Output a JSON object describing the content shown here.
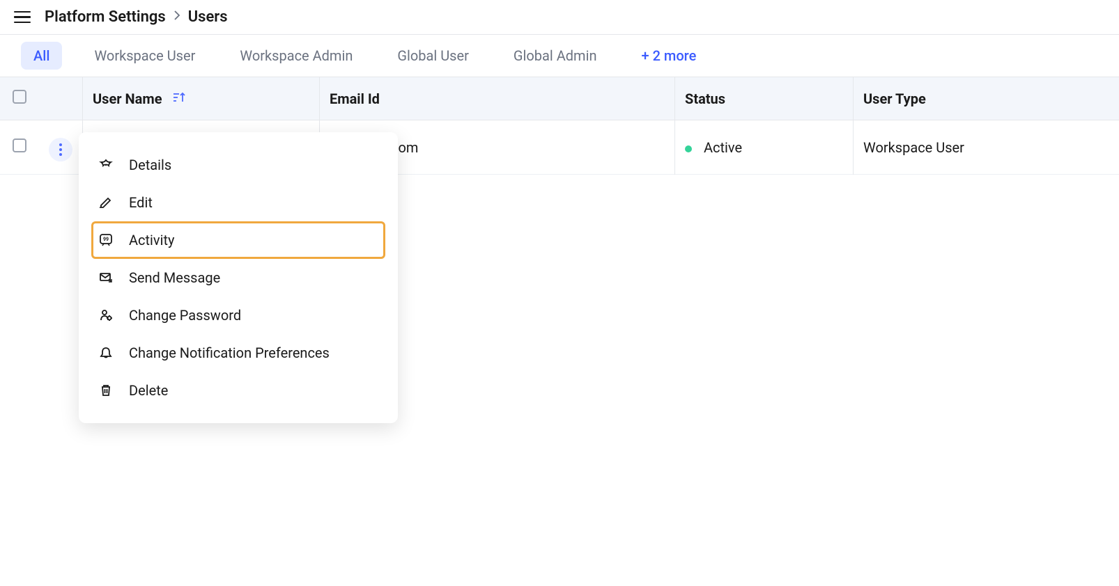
{
  "breadcrumb": {
    "parent": "Platform Settings",
    "current": "Users"
  },
  "tabs": {
    "items": [
      "All",
      "Workspace User",
      "Workspace Admin",
      "Global User",
      "Global Admin"
    ],
    "more": "+ 2 more",
    "activeIndex": 0
  },
  "columns": {
    "name": "User Name",
    "email": "Email Id",
    "status": "Status",
    "type": "User Type"
  },
  "rows": [
    {
      "email": "@sprinklr.com",
      "status": "Active",
      "type": "Workspace User"
    }
  ],
  "menu": {
    "details": "Details",
    "edit": "Edit",
    "activity": "Activity",
    "sendMessage": "Send Message",
    "changePassword": "Change Password",
    "changeNotif": "Change Notification Preferences",
    "delete": "Delete"
  }
}
